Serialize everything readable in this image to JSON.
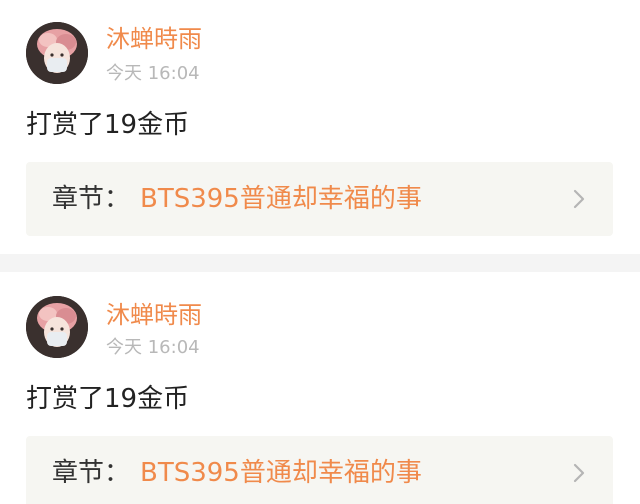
{
  "posts": [
    {
      "username": "沐蝉時雨",
      "time": "今天 16:04",
      "message": "打赏了19金币",
      "chapter_prefix": "章节：",
      "chapter_title": "BTS395普通却幸福的事",
      "avatar_icon": "user-avatar",
      "chevron_icon": "chevron-right-icon"
    },
    {
      "username": "沐蝉時雨",
      "time": "今天 16:04",
      "message": "打赏了19金币",
      "chapter_prefix": "章节：",
      "chapter_title": "BTS395普通却幸福的事",
      "avatar_icon": "user-avatar",
      "chevron_icon": "chevron-right-icon"
    }
  ],
  "colors": {
    "accent": "#f08a4b",
    "time": "#b8b8b8",
    "text": "#222222",
    "chapter_bg": "#f6f6f2",
    "divider": "#f4f4f4"
  }
}
